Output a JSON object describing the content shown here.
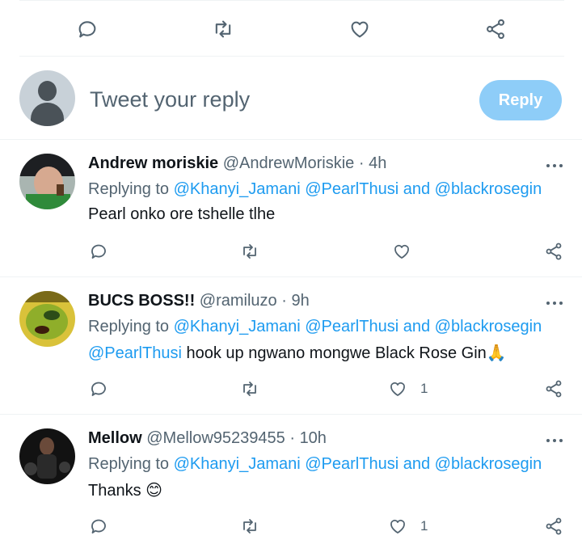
{
  "top_actions": {
    "reply_icon": "comment-icon",
    "retweet_icon": "retweet-icon",
    "like_icon": "heart-icon",
    "share_icon": "share-icon"
  },
  "composer": {
    "placeholder": "Tweet your reply",
    "reply_label": "Reply"
  },
  "tweets": [
    {
      "name": "Andrew moriskie",
      "handle": "@AndrewMoriskie",
      "separator": "·",
      "time": "4h",
      "replying_prefix": "Replying to",
      "mention_1": "@Khanyi_Jamani",
      "mention_2": "@PearlThusi",
      "and_word": "and",
      "mention_3": "@blackrosegin",
      "text": "Pearl onko ore tshelle tlhe",
      "like_count": ""
    },
    {
      "name": "BUCS BOSS!!",
      "handle": "@ramiluzo",
      "separator": "·",
      "time": "9h",
      "replying_prefix": "Replying to",
      "mention_1": "@Khanyi_Jamani",
      "mention_2": "@PearlThusi",
      "and_word": "and",
      "mention_3": "@blackrosegin",
      "text_mention": "@PearlThusi",
      "text": " hook up ngwano mongwe Black Rose Gin",
      "emoji": "🙏",
      "like_count": "1"
    },
    {
      "name": "Mellow",
      "handle": "@Mellow95239455",
      "separator": "·",
      "time": "10h",
      "replying_prefix": "Replying to",
      "mention_1": "@Khanyi_Jamani",
      "mention_2": "@PearlThusi",
      "and_word": "and",
      "mention_3": "@blackrosegin",
      "text": "Thanks ",
      "emoji": "😊",
      "like_count": "1"
    }
  ],
  "colors": {
    "accent": "#1d9bf0",
    "reply_button_disabled": "#8ecdf8",
    "secondary_text": "#536471",
    "divider": "#eff3f4"
  }
}
